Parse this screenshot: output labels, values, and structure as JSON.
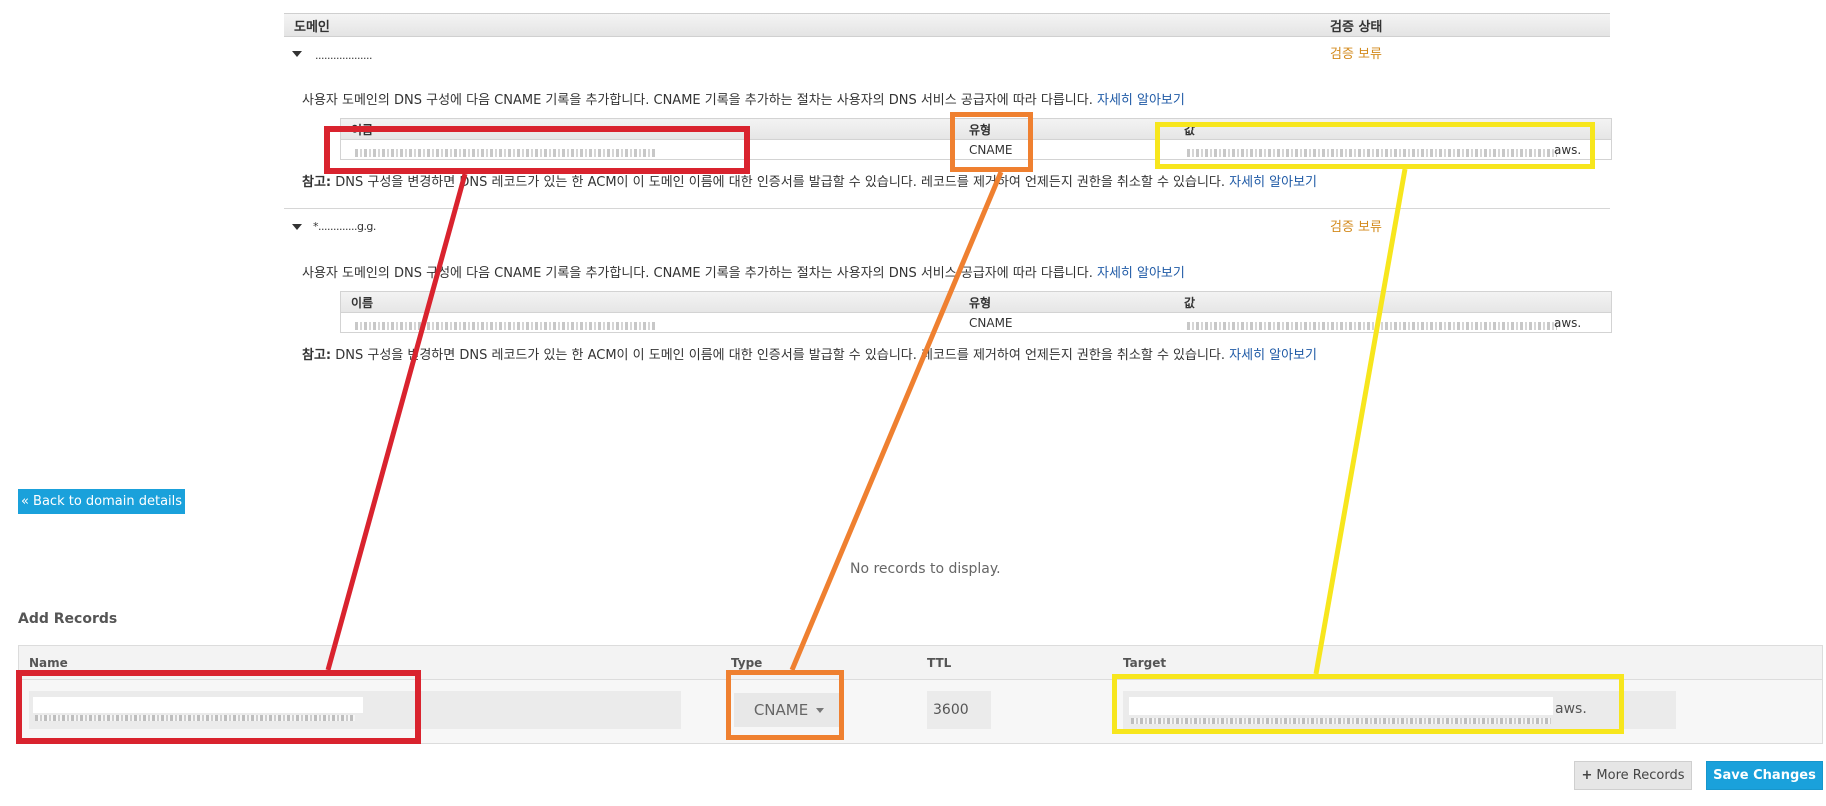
{
  "acm": {
    "header": {
      "domain_label": "도메인",
      "status_label": "검증 상태"
    },
    "domains": [
      {
        "name": "...................",
        "status": "검증 보류",
        "instruction": "사용자 도메인의 DNS 구성에 다음 CNAME 기록을 추가합니다. CNAME 기록을 추가하는 절차는 사용자의 DNS 서비스 공급자에 따라 다릅니다.",
        "instruction_link": "자세히 알아보기",
        "table": {
          "name_header": "이름",
          "type_header": "유형",
          "value_header": "값",
          "type": "CNAME",
          "value_suffix": "aws."
        },
        "note_prefix": "참고:",
        "note_text": " DNS 구성을 변경하면 DNS 레코드가 있는 한 ACM이 이 도메인 이름에 대한 인증서를 발급할 수 있습니다. 레코드를 제거하여 언제든지 권한을 취소할 수 있습니다.",
        "note_link": "자세히 알아보기"
      },
      {
        "name": "*.............g.g.",
        "status": "검증 보류",
        "instruction": "사용자 도메인의 DNS 구성에 다음 CNAME 기록을 추가합니다. CNAME 기록을 추가하는 절차는 사용자의 DNS 서비스 공급자에 따라 다릅니다.",
        "instruction_link": "자세히 알아보기",
        "table": {
          "name_header": "이름",
          "type_header": "유형",
          "value_header": "값",
          "type": "CNAME",
          "value_suffix": "aws."
        },
        "note_prefix": "참고:",
        "note_text": " DNS 구성을 변경하면 DNS 레코드가 있는 한 ACM이 이 도메인 이름에 대한 인증서를 발급할 수 있습니다. 레코드를 제거하여 언제든지 권한을 취소할 수 있습니다.",
        "note_link": "자세히 알아보기"
      }
    ]
  },
  "route53": {
    "back_button": "« Back to domain details",
    "no_records": "No records to display.",
    "add_records_title": "Add Records",
    "columns": {
      "name": "Name",
      "type": "Type",
      "ttl": "TTL",
      "target": "Target"
    },
    "row": {
      "type": "CNAME",
      "ttl": "3600",
      "target_suffix": "aws."
    },
    "more_records_button": "More Records",
    "more_records_icon": "plus-icon",
    "save_button": "Save Changes"
  },
  "annotations": {
    "colors": {
      "name": "#d9232e",
      "type": "#ef8030",
      "value": "#f7e61d"
    }
  }
}
